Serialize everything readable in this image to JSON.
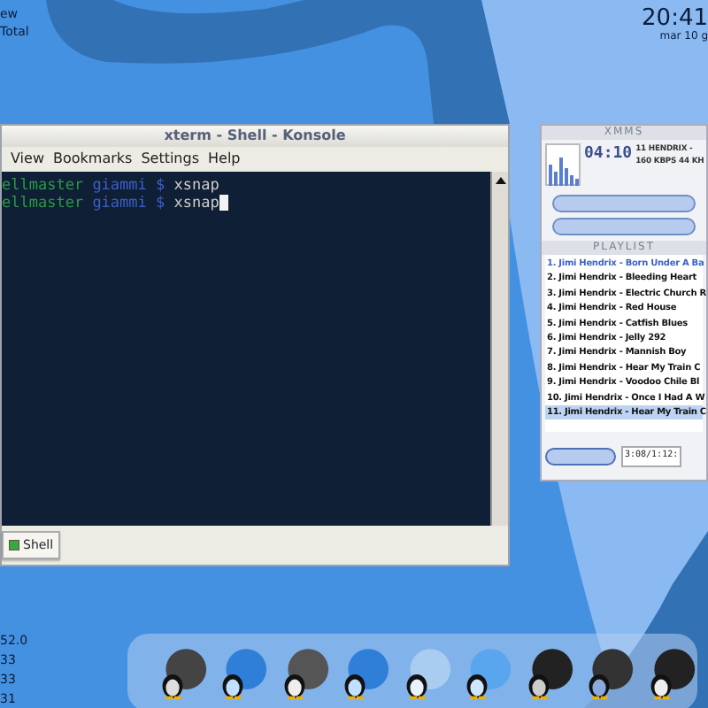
{
  "desktop": {
    "monitor_lines": [
      "ew",
      "Total"
    ],
    "stats": [
      "52.0",
      "33",
      "33",
      "31"
    ],
    "clock": {
      "time": "20:41",
      "date": "mar 10 g"
    }
  },
  "konsole": {
    "title": "xterm - Shell - Konsole",
    "menu": [
      "View",
      "Bookmarks",
      "Settings",
      "Help"
    ],
    "lines": [
      {
        "host": "ellmaster",
        "user": "giammi",
        "prompt": "$",
        "command": "xsnap",
        "cursor": false
      },
      {
        "host": "ellmaster",
        "user": "giammi",
        "prompt": "$",
        "command": "xsnap",
        "cursor": true
      }
    ],
    "tabs": [
      {
        "label": "Shell",
        "selected": true
      }
    ]
  },
  "xmms": {
    "title": "XMMS",
    "time": "04:10",
    "song": "11 HENDRIX -",
    "info": "160 KBPS 44 KH",
    "playlist_title": "PLAYLIST",
    "playlist_time": "3:08/1:12:",
    "playlist": [
      {
        "label": "1. Jimi Hendrix - Born Under A Ba",
        "playing": true,
        "selected": false
      },
      {
        "label": "2. Jimi Hendrix - Bleeding Heart",
        "playing": false,
        "selected": false
      },
      {
        "label": "3. Jimi Hendrix - Electric Church R",
        "playing": false,
        "selected": false
      },
      {
        "label": "4. Jimi Hendrix - Red House",
        "playing": false,
        "selected": false
      },
      {
        "label": "5. Jimi Hendrix - Catfish Blues",
        "playing": false,
        "selected": false
      },
      {
        "label": "6. Jimi Hendrix - Jelly 292",
        "playing": false,
        "selected": false
      },
      {
        "label": "7. Jimi Hendrix - Mannish Boy",
        "playing": false,
        "selected": false
      },
      {
        "label": "8. Jimi Hendrix - Hear My Train C",
        "playing": false,
        "selected": false
      },
      {
        "label": "9. Jimi Hendrix - Voodoo Chile Bl",
        "playing": false,
        "selected": false
      },
      {
        "label": "10. Jimi Hendrix - Once I Had A W",
        "playing": false,
        "selected": false
      },
      {
        "label": "11. Jimi Hendrix - Hear My Train C",
        "playing": false,
        "selected": true
      }
    ]
  }
}
